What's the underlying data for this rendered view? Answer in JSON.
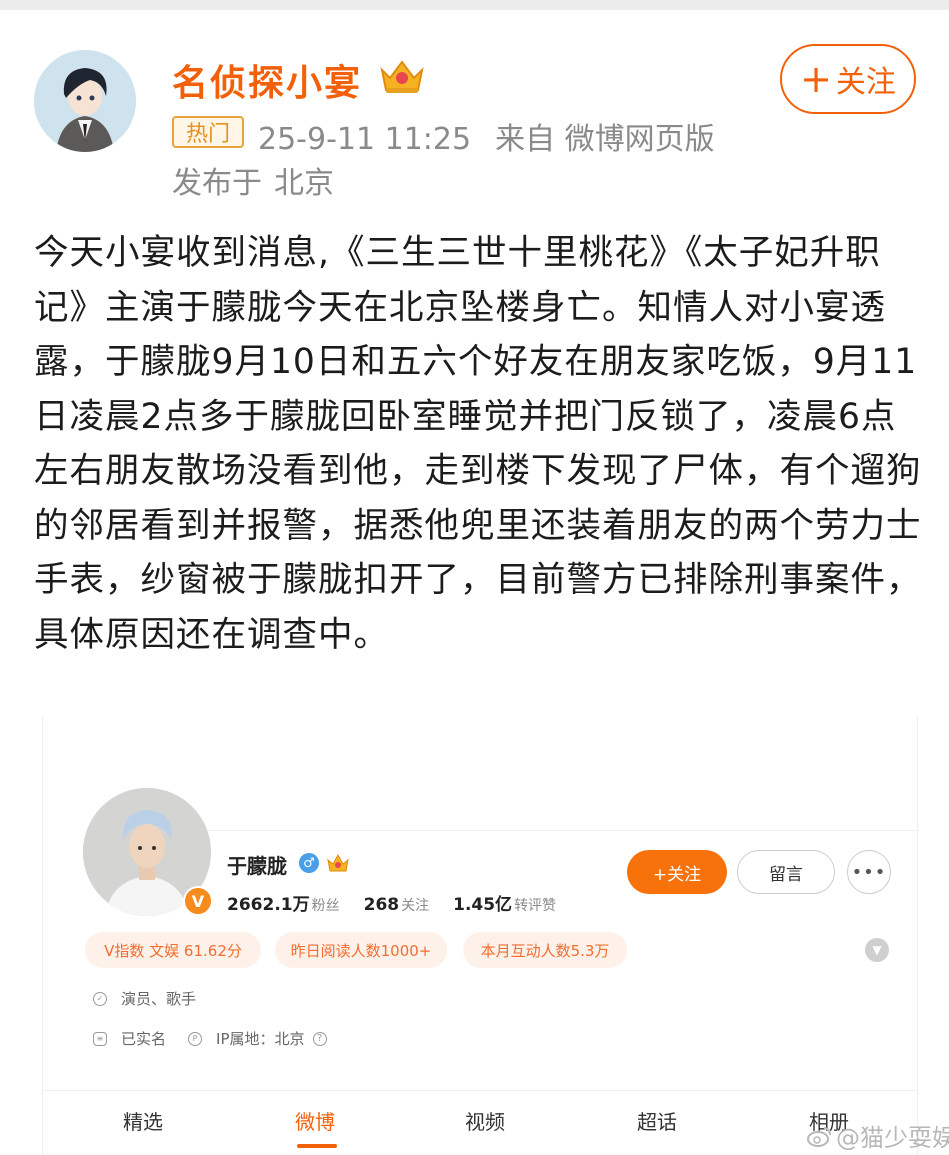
{
  "post": {
    "author": "名侦探小宴",
    "follow_label": "关注",
    "hot_badge": "热门",
    "timestamp": "25-9-11 11:25",
    "source": "来自 微博网页版",
    "posted_from_label": "发布于",
    "location": "北京",
    "body": "今天小宴收到消息,《三生三世十里桃花》《太子妃升职记》主演于朦胧今天在北京坠楼身亡。知情人对小宴透露，于朦胧9月10日和五六个好友在朋友家吃饭，9月11日凌晨2点多于朦胧回卧室睡觉并把门反锁了，凌晨6点左右朋友散场没看到他，走到楼下发现了尸体，有个遛狗的邻居看到并报警，据悉他兜里还装着朋友的两个劳力士手表，纱窗被于朦胧扣开了，目前警方已排除刑事案件，具体原因还在调查中。"
  },
  "profile": {
    "name": "于朦胧",
    "verified_badge": "V",
    "followers_value": "2662.1万",
    "followers_label": "粉丝",
    "following_value": "268",
    "following_label": "关注",
    "engagement_value": "1.45亿",
    "engagement_label": "转评赞",
    "follow_button": "+关注",
    "message_button": "留言",
    "more_button": "•••",
    "tags": [
      "V指数 文娱 61.62分",
      "昨日阅读人数1000+",
      "本月互动人数5.3万"
    ],
    "occupation": "演员、歌手",
    "real_name_status": "已实名",
    "ip_location": "IP属地：北京",
    "tabs": [
      "精选",
      "微博",
      "视频",
      "超话",
      "相册"
    ],
    "active_tab": "微博"
  },
  "watermark": "@猫少耍娱",
  "colors": {
    "accent_orange": "#f2610a",
    "hot_badge": "#e39220",
    "tag_background": "#fdf1e9",
    "gender_blue": "#4a9fe6"
  },
  "icons": [
    "crown-icon",
    "plus-icon",
    "gender-male-icon",
    "vip-icon",
    "verified-v-icon",
    "shield-icon",
    "id-card-icon",
    "ip-icon",
    "help-icon",
    "chevron-down-icon",
    "weibo-logo-icon"
  ]
}
